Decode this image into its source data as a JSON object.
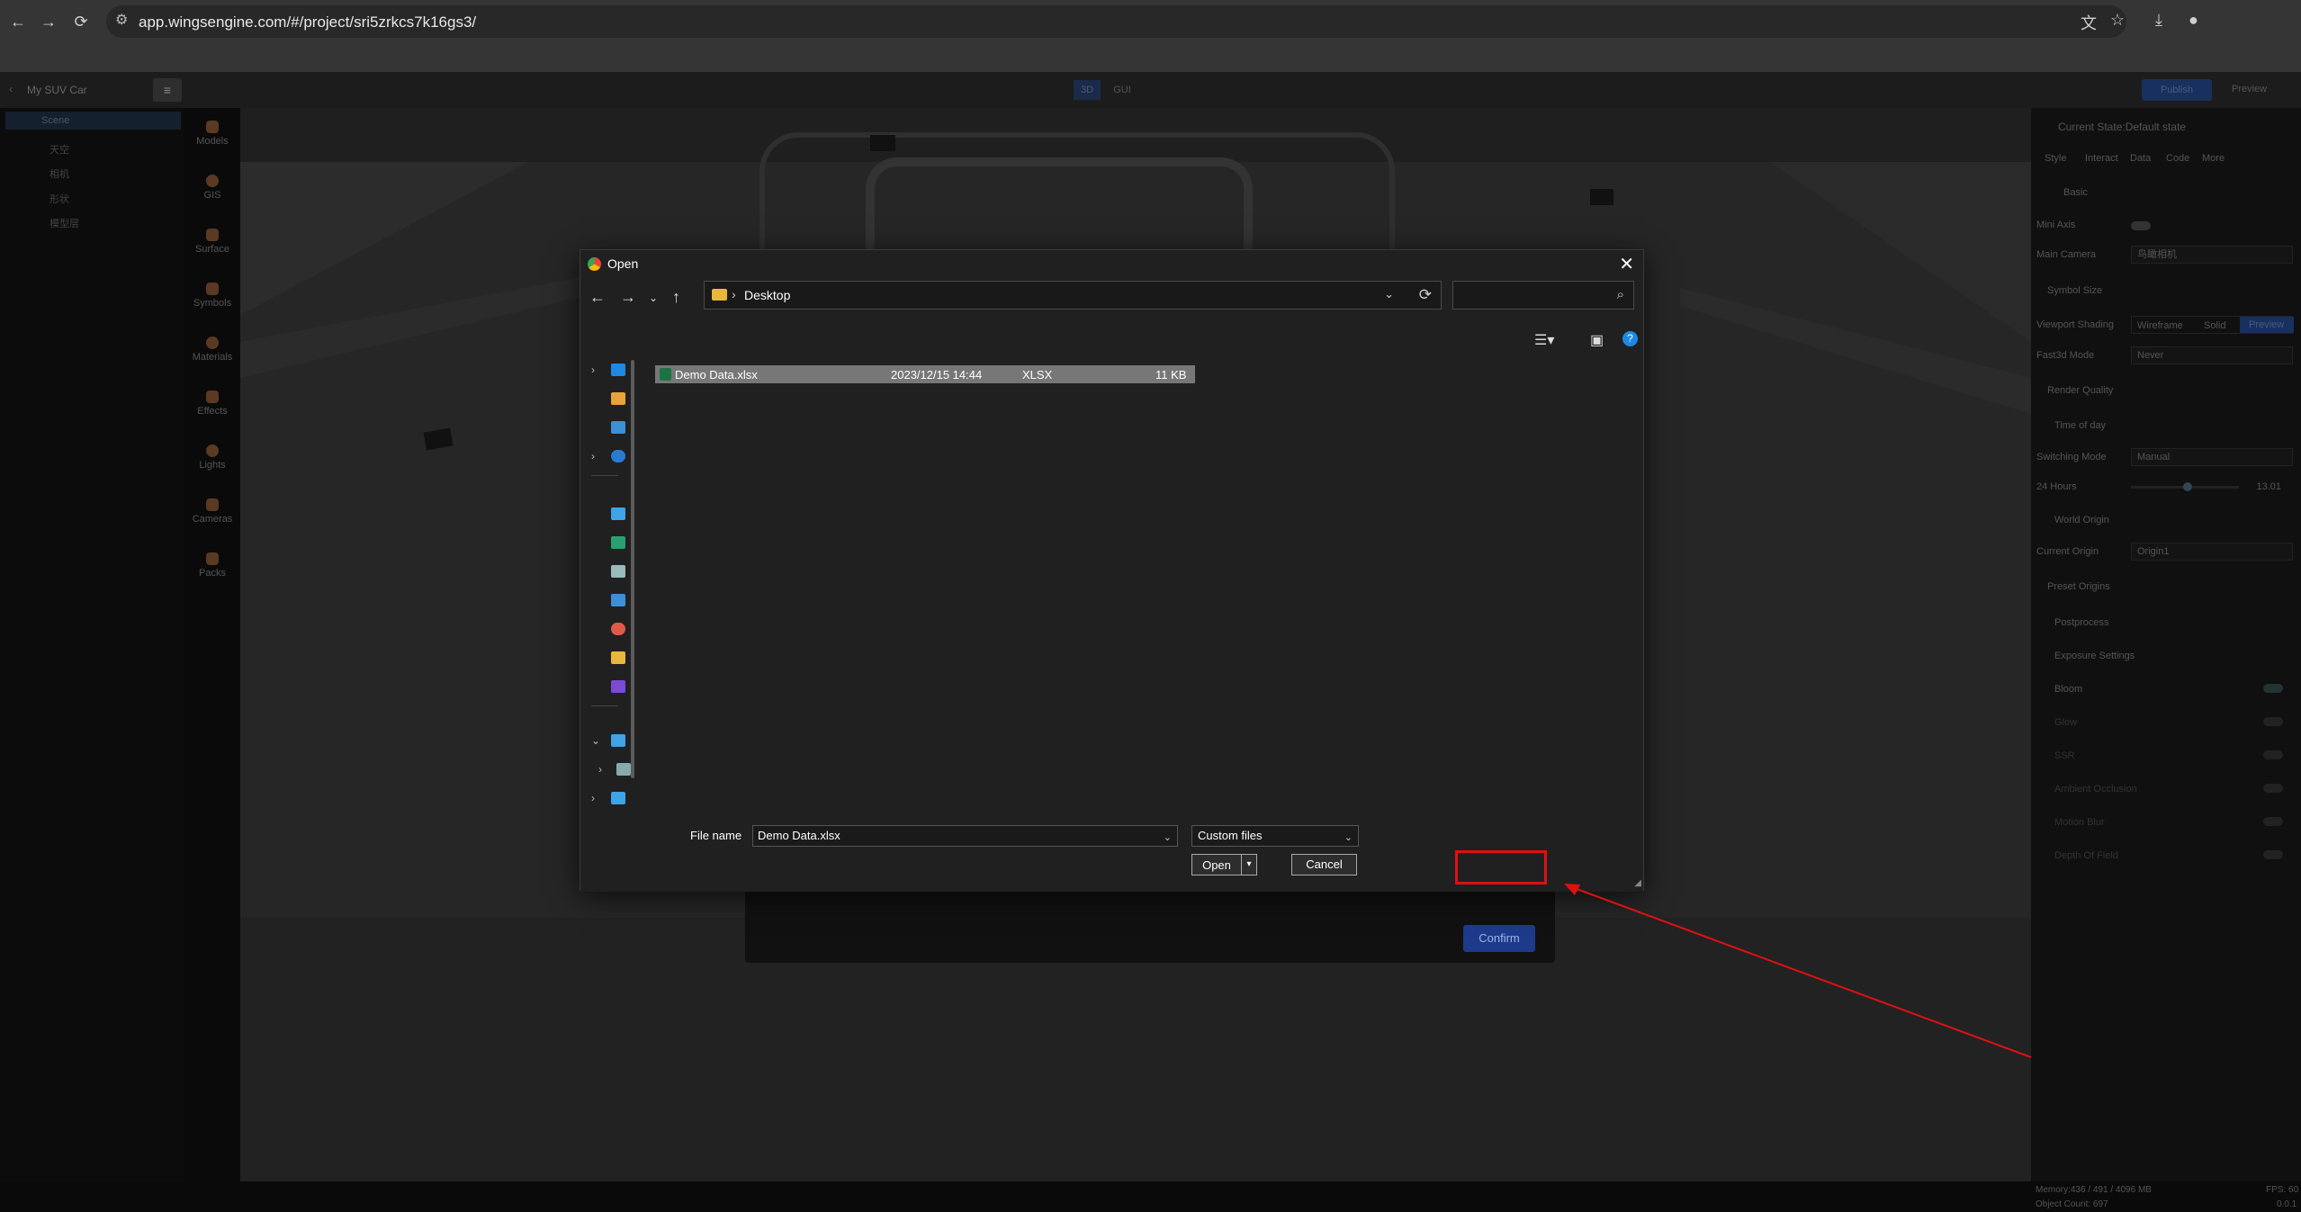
{
  "browser": {
    "url": "app.wingsengine.com/#/project/sri5zrkcs7k16gs3/"
  },
  "app": {
    "project_name": "My SUV Car",
    "mode_tabs": [
      "3D",
      "GUI"
    ],
    "publish_label": "Publish",
    "preview_label": "Preview",
    "scene_tree": [
      {
        "label": "Scene"
      },
      {
        "label": "天空"
      },
      {
        "label": "相机"
      },
      {
        "label": "形状"
      },
      {
        "label": "模型层"
      }
    ],
    "tools": [
      "Models",
      "GIS",
      "Surface",
      "Symbols",
      "Materials",
      "Effects",
      "Lights",
      "Cameras",
      "Packs"
    ],
    "right_panel": {
      "state_title": "Current State:Default state",
      "tabs": [
        "Style",
        "Interact",
        "Data",
        "Code",
        "More"
      ],
      "sections": {
        "basic": "Basic",
        "mini_axis": "Mini Axis",
        "main_camera": "Main Camera",
        "main_camera_value": "鸟瞰相机",
        "symbol_size": "Symbol Size",
        "viewport_shading": "Viewport Shading",
        "shading_options": [
          "Wireframe",
          "Solid",
          "Preview"
        ],
        "fast3d_mode": "Fast3d Mode",
        "fast3d_value": "Never",
        "render_quality": "Render Quality",
        "time_of_day": "Time of day",
        "switching_mode": "Switching Mode",
        "switching_value": "Manual",
        "hours_label": "24 Hours",
        "hours_value": "13.01",
        "world_origin": "World Origin",
        "current_origin": "Current Origin",
        "current_origin_value": "Origin1",
        "preset_origins": "Preset Origins",
        "postprocess": "Postprocess",
        "exposure": "Exposure Settings",
        "bloom": "Bloom",
        "glow": "Glow",
        "ssr": "SSR",
        "ambient_occlusion": "Ambient Occlusion",
        "motion_blur": "Motion Blur",
        "depth_of_field": "Depth Of Field"
      }
    },
    "status": {
      "memory": "Memory:436 / 491 / 4096 MB",
      "object_count": "Object Count: 697",
      "fps": "FPS: 60",
      "version": "0.0.1"
    },
    "confirm_label": "Confirm"
  },
  "dialog": {
    "title": "Open",
    "location": "Desktop",
    "files": [
      {
        "name": "Demo Data.xlsx",
        "modified": "2023/12/15 14:44",
        "type": "XLSX",
        "size": "11 KB"
      }
    ],
    "file_name_label": "File name",
    "file_name_value": "Demo Data.xlsx",
    "file_type": "Custom files",
    "open_label": "Open",
    "cancel_label": "Cancel"
  },
  "annotation_color": "#e01010"
}
